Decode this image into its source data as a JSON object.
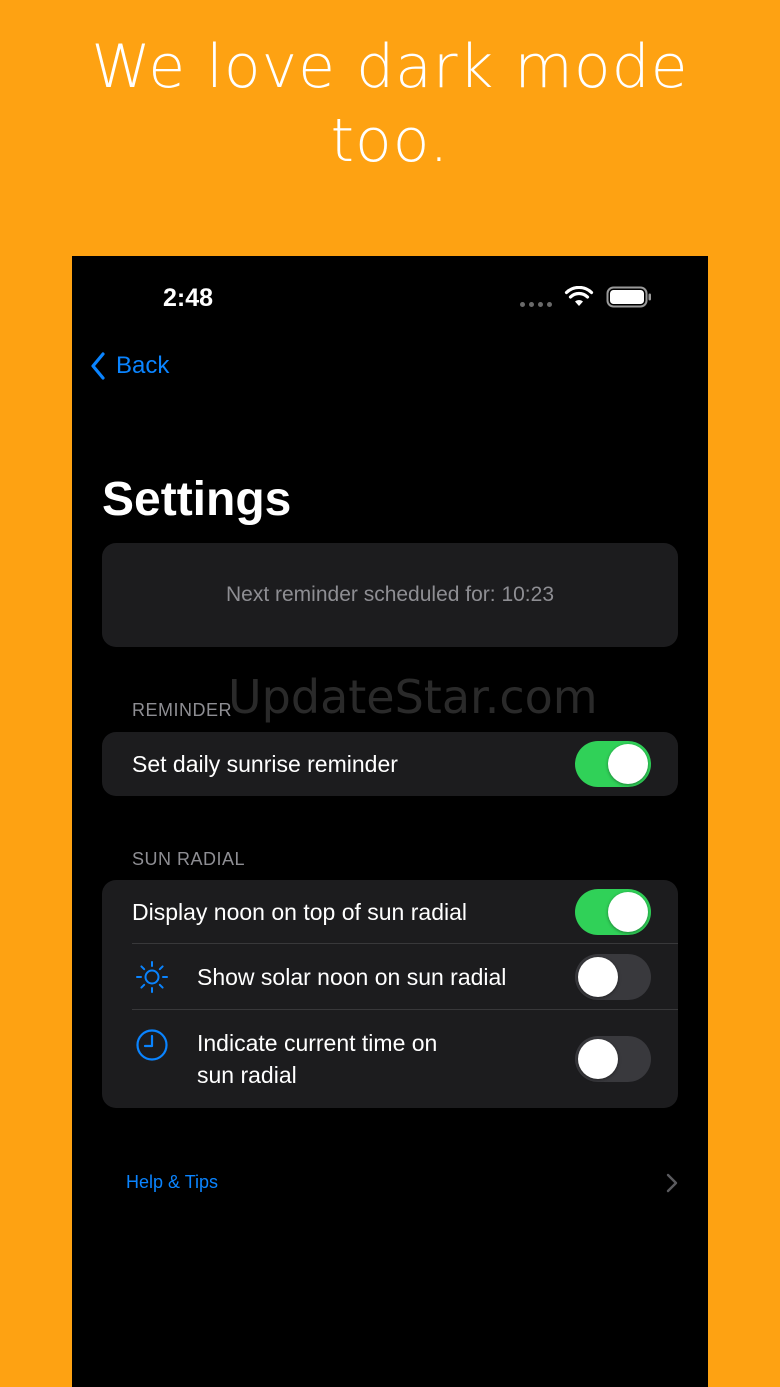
{
  "headline": {
    "line1": "We love dark mode",
    "line2": "too."
  },
  "status_bar": {
    "time": "2:48",
    "icons": [
      "cellular-signal-icon",
      "wifi-icon",
      "battery-icon"
    ]
  },
  "nav": {
    "back_label": "Back",
    "back_icon": "chevron-left-icon"
  },
  "page": {
    "title": "Settings",
    "next_reminder": "Next reminder scheduled for: 10:23"
  },
  "sections": {
    "reminder": {
      "header": "REMINDER",
      "items": [
        {
          "label": "Set daily sunrise reminder",
          "enabled": true
        }
      ]
    },
    "sun_radial": {
      "header": "SUN RADIAL",
      "items": [
        {
          "label": "Display noon on top of sun radial",
          "enabled": true,
          "icon": ""
        },
        {
          "label": "Show solar noon on sun radial",
          "enabled": false,
          "icon": "sun-icon"
        },
        {
          "label_line1": "Indicate current time on",
          "label_line2": "sun radial",
          "enabled": false,
          "icon": "clock-icon"
        }
      ]
    }
  },
  "footer": {
    "help_label": "Help & Tips",
    "help_icon": "chevron-right-icon"
  },
  "watermark": "UpdateStar.com",
  "colors": {
    "background": "#FEA212",
    "screen": "#000000",
    "card": "#1C1C1E",
    "accent": "#0A84FF",
    "toggle_on": "#30D158",
    "toggle_off": "#39393D",
    "secondary_text": "#8E8E93"
  }
}
